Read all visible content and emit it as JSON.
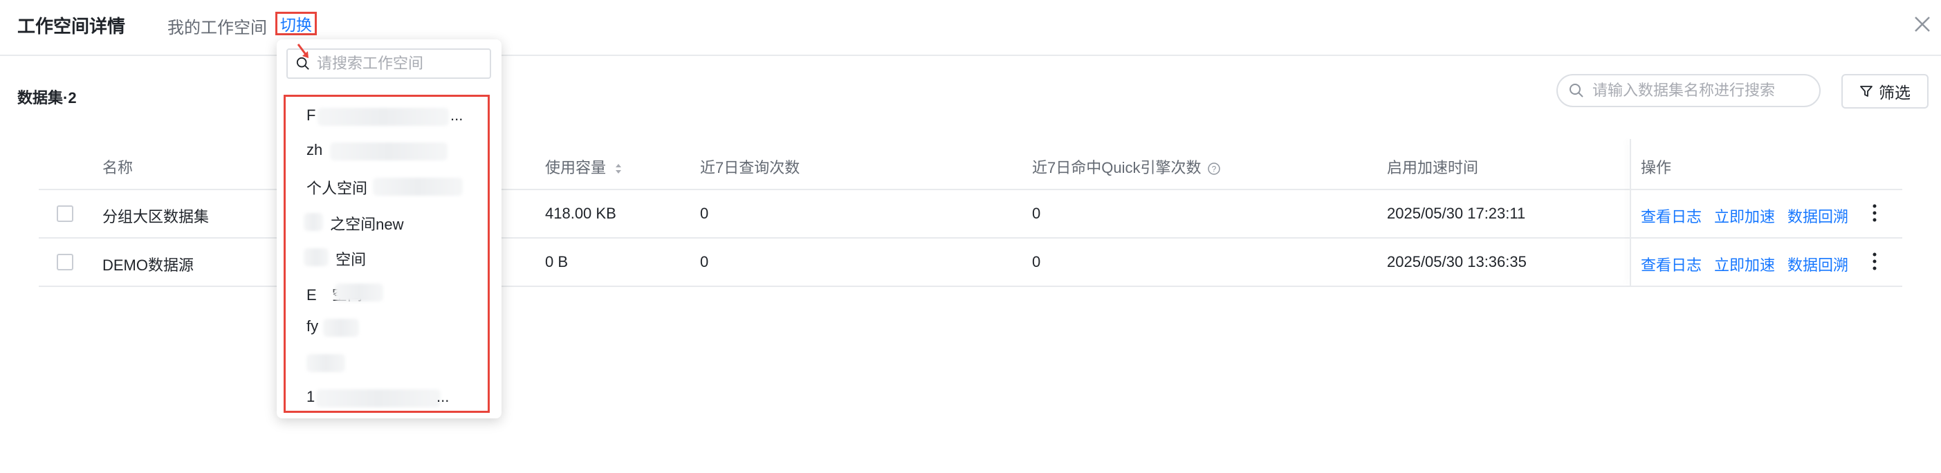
{
  "header": {
    "title": "工作空间详情",
    "my_workspace_label": "我的工作空间",
    "switch_label": "切换"
  },
  "dataset_count_label": "数据集·2",
  "toolbar": {
    "search_placeholder": "请输入数据集名称进行搜索",
    "filter_label": "筛选"
  },
  "table": {
    "columns": [
      "名称",
      "使用容量",
      "近7日查询次数",
      "近7日命中Quick引擎次数",
      "启用加速时间",
      "操作"
    ],
    "rows": [
      {
        "name": "分组大区数据集",
        "capacity": "418.00 KB",
        "queries": "0",
        "hits": "0",
        "time": "2025/05/30 17:23:11"
      },
      {
        "name": "DEMO数据源",
        "capacity": "0 B",
        "queries": "0",
        "hits": "0",
        "time": "2025/05/30 13:36:35"
      }
    ],
    "actions": {
      "view_log": "查看日志",
      "accelerate": "立即加速",
      "backfill": "数据回溯"
    }
  },
  "dropdown": {
    "search_placeholder": "请搜索工作空间",
    "items": [
      "F",
      "zh",
      "个人空间",
      "之空间new",
      "空间",
      "E",
      "fy",
      "",
      "1"
    ],
    "ellipsis": "..."
  },
  "colors": {
    "accent": "#1677ff",
    "highlight_box": "#e8453c"
  }
}
